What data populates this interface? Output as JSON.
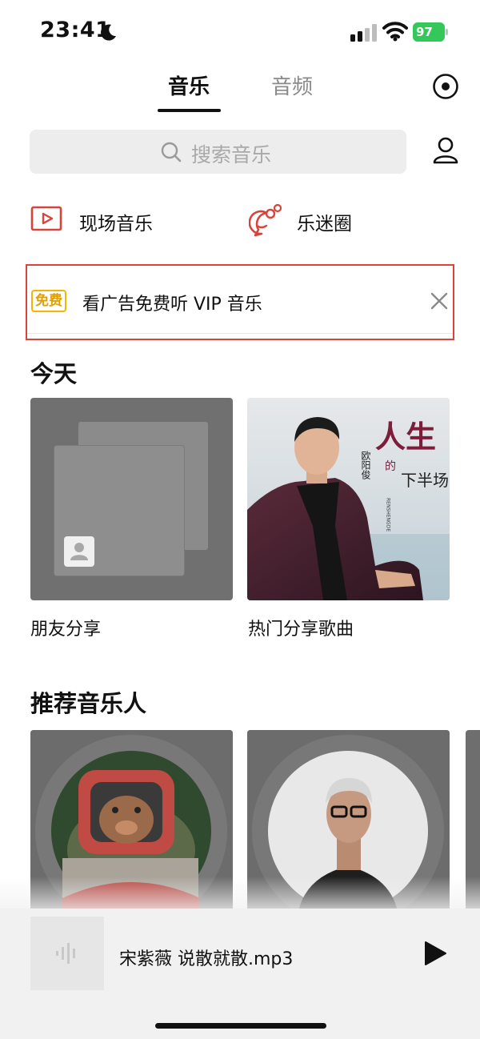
{
  "status_bar": {
    "time": "23:41",
    "battery": "97"
  },
  "tabs": [
    {
      "label": "音乐",
      "active": true
    },
    {
      "label": "音频",
      "active": false
    }
  ],
  "search": {
    "placeholder": "搜索音乐"
  },
  "shortcuts": [
    {
      "label": "现场音乐",
      "icon": "live-video-icon"
    },
    {
      "label": "乐迷圈",
      "icon": "chat-bubbles-icon"
    }
  ],
  "ad_banner": {
    "badge": "免费",
    "text": "看广告免费听 VIP 音乐"
  },
  "today": {
    "title": "今天",
    "cards": [
      {
        "label": "朋友分享"
      },
      {
        "label": "热门分享歌曲",
        "cover": {
          "artist": "欧阳俊",
          "title_line1": "人生",
          "title_de": "的",
          "title_line2": "下半场",
          "pinyin": "RENSHENGDE"
        }
      }
    ]
  },
  "recommended": {
    "title": "推荐音乐人"
  },
  "player": {
    "track": "宋紫薇 说散就散.mp3"
  },
  "colors": {
    "accent_red": "#d9443a",
    "badge_yellow": "#f4b400",
    "battery_green": "#34c759"
  }
}
